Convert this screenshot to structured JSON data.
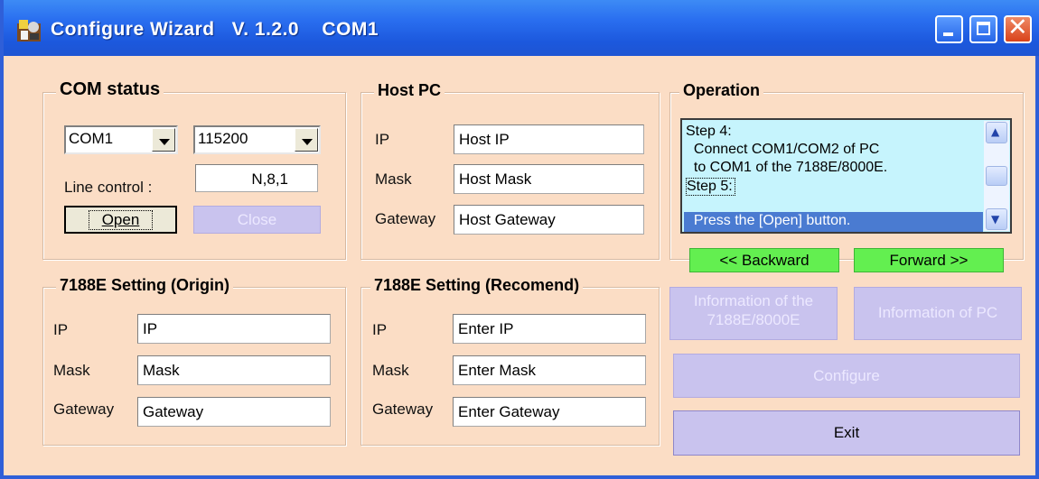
{
  "window": {
    "title": "Configure Wizard   V. 1.2.0    COM1"
  },
  "com_status": {
    "title": "COM status",
    "port": "COM1",
    "baud": "115200",
    "line_control_label": "Line control :",
    "line_control_value": "N,8,1",
    "open_label": "Open",
    "close_label": "Close"
  },
  "host_pc": {
    "title": "Host PC",
    "ip_label": "IP",
    "ip_value": "Host IP",
    "mask_label": "Mask",
    "mask_value": "Host Mask",
    "gateway_label": "Gateway",
    "gateway_value": "Host Gateway"
  },
  "operation": {
    "title": "Operation",
    "lines": [
      "Step 4:",
      "  Connect COM1/COM2 of PC",
      "  to COM1 of the 7188E/8000E.",
      "Step 5:",
      "  Press the [Open] button."
    ],
    "backward_label": "<< Backward",
    "forward_label": "Forward >>"
  },
  "origin": {
    "title": "7188E Setting (Origin)",
    "ip_label": "IP",
    "ip_value": "IP",
    "mask_label": "Mask",
    "mask_value": "Mask",
    "gateway_label": "Gateway",
    "gateway_value": "Gateway"
  },
  "recommend": {
    "title": "7188E Setting (Recomend)",
    "ip_label": "IP",
    "ip_value": "Enter IP",
    "mask_label": "Mask",
    "mask_value": "Enter Mask",
    "gateway_label": "Gateway",
    "gateway_value": "Enter Gateway"
  },
  "actions": {
    "info_device_line1": "Information of the",
    "info_device_line2": "7188E/8000E",
    "info_pc": "Information of  PC",
    "configure": "Configure",
    "exit": "Exit"
  },
  "colors": {
    "titlebar": "#1c58dd",
    "background": "#fbddc5",
    "list_bg": "#c6f4fd",
    "selection": "#4a7bd1",
    "green": "#63ef50",
    "button_purple": "#c9c3ee"
  }
}
